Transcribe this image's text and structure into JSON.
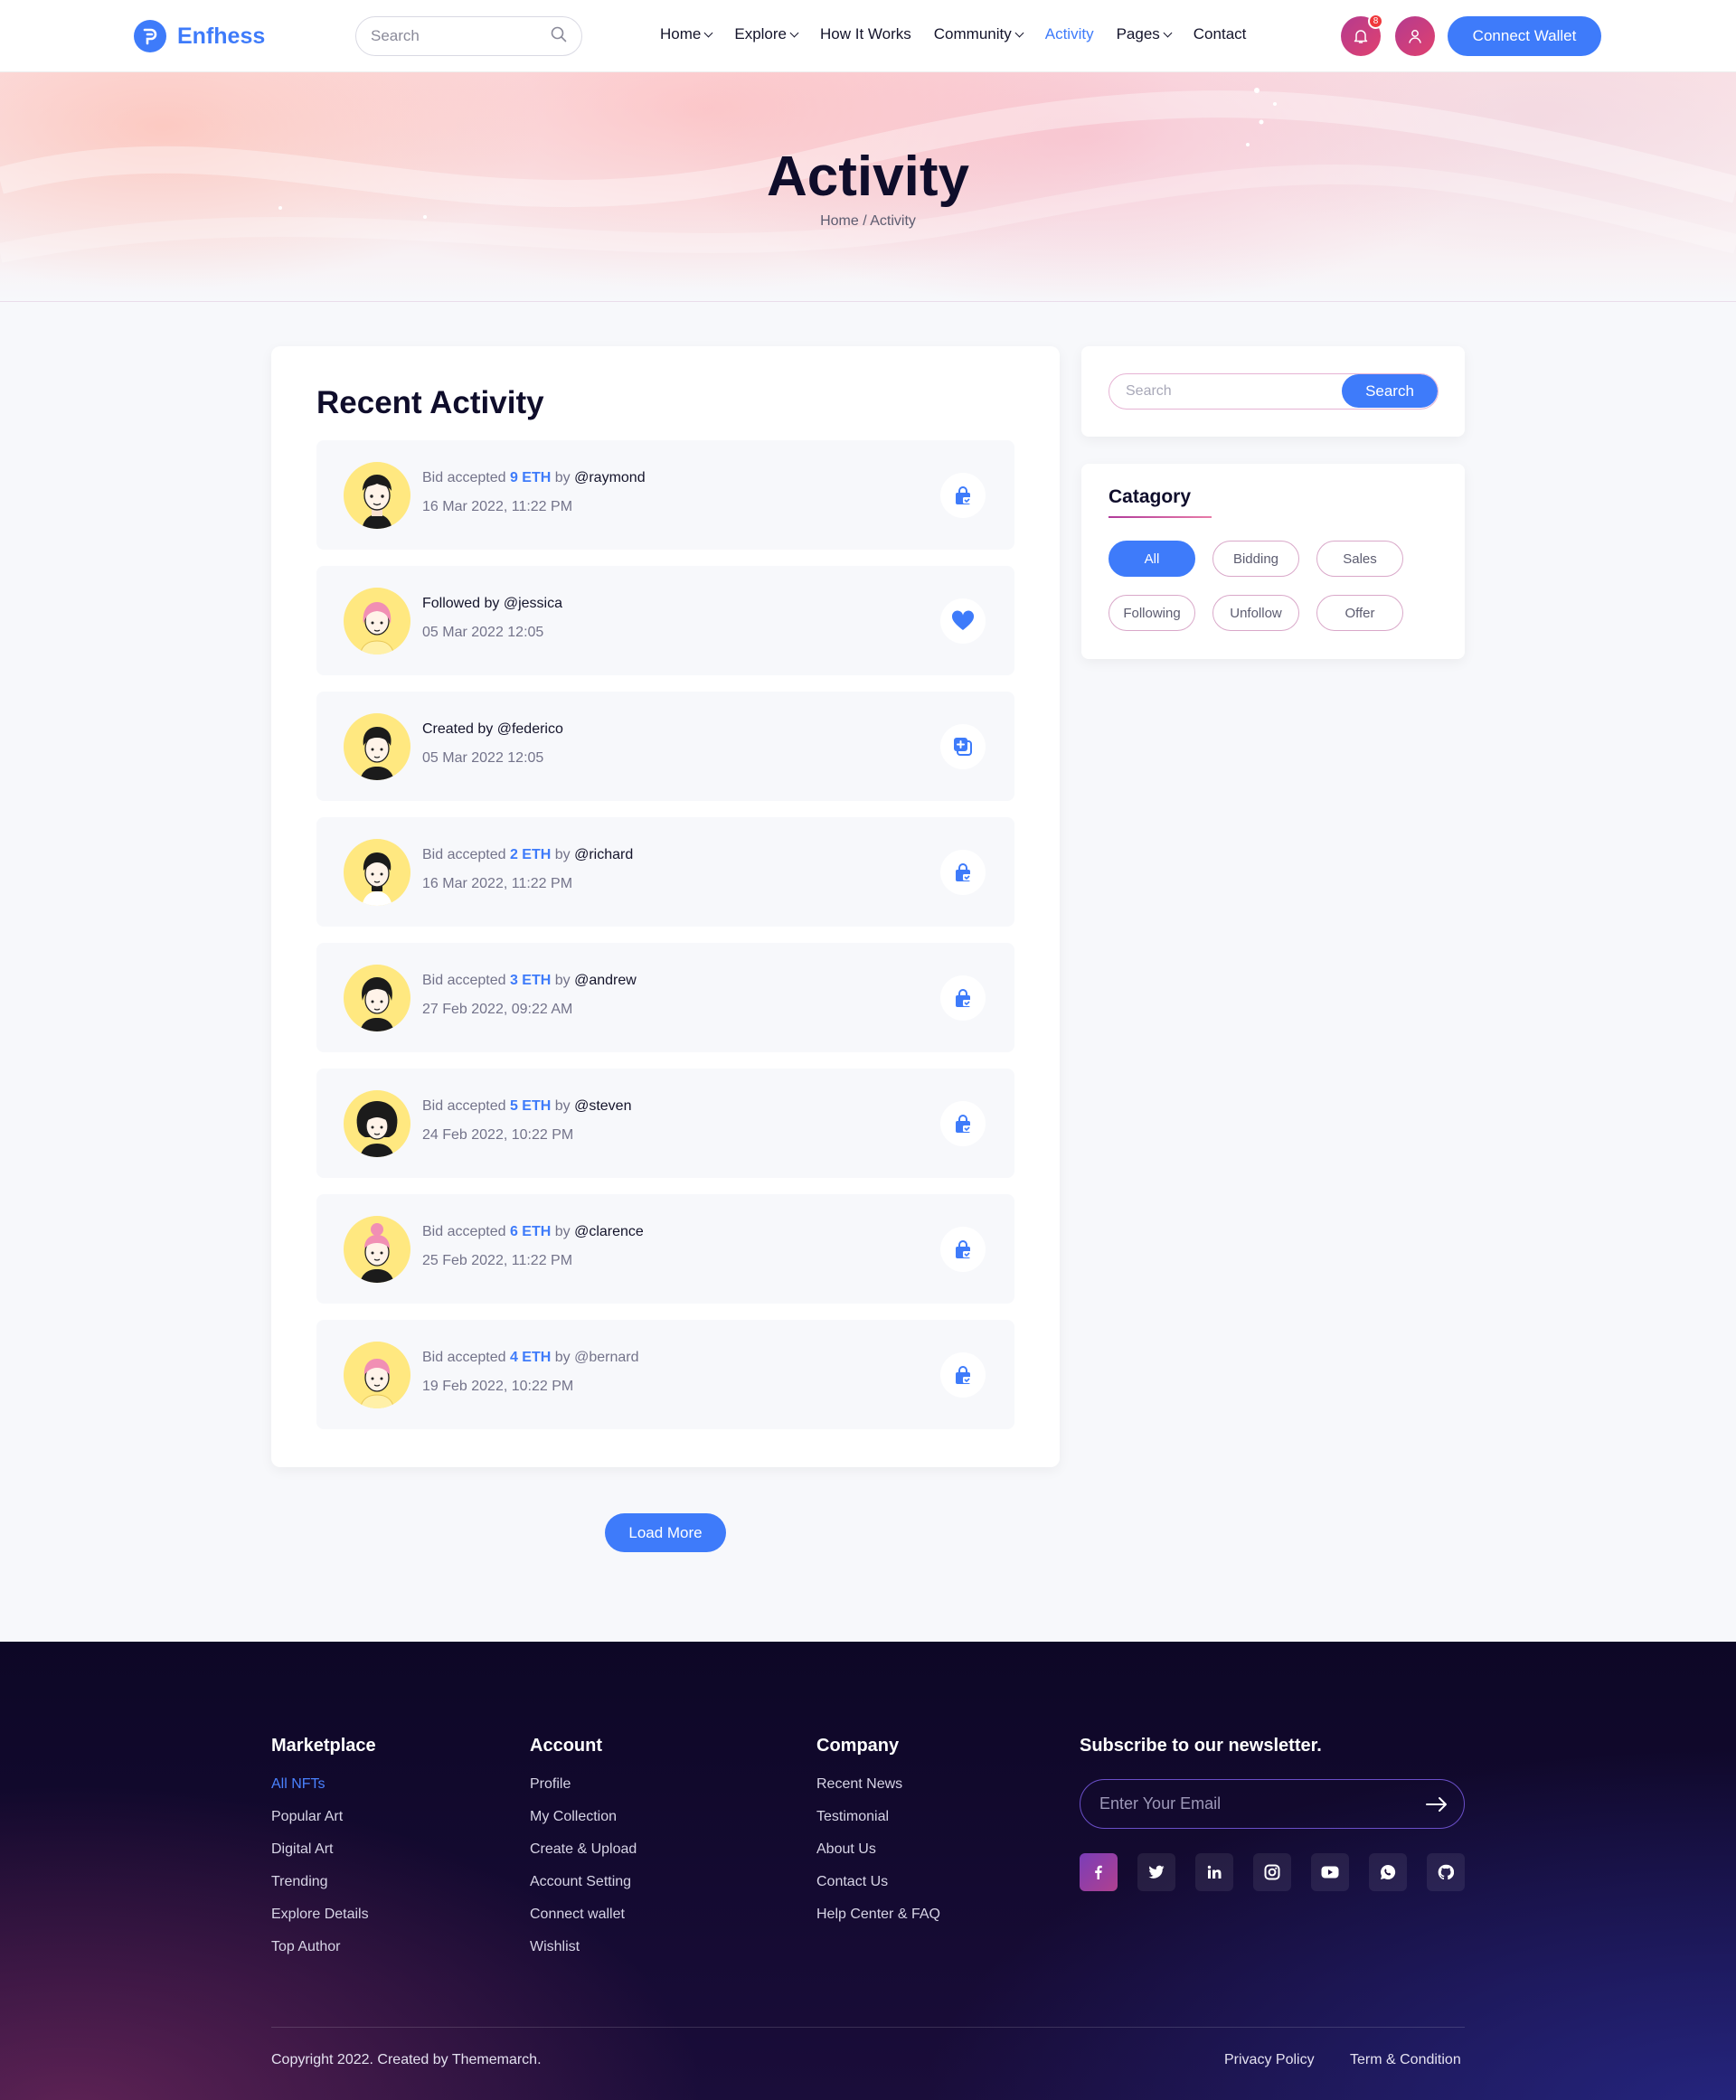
{
  "header": {
    "brand": "Enfhess",
    "search_placeholder": "Search",
    "nav": [
      {
        "label": "Home"
      },
      {
        "label": "Explore"
      },
      {
        "label": "How It Works"
      },
      {
        "label": "Community"
      },
      {
        "label": "Activity"
      },
      {
        "label": "Pages"
      },
      {
        "label": "Contact"
      }
    ],
    "notification_count": "8",
    "wallet_label": "Connect Wallet"
  },
  "hero": {
    "title": "Activity",
    "breadcrumb": "Home / Activity"
  },
  "activity": {
    "title": "Recent Activity",
    "items": [
      {
        "prefix": "Bid accepted ",
        "amount": "9 ETH",
        "mid": " by ",
        "user": "@raymond",
        "time": "16 Mar 2022, 11:22 PM",
        "icon": "bag-icon"
      },
      {
        "text": "Followed by @jessica",
        "time": "05 Mar 2022 12:05",
        "icon": "heart-icon"
      },
      {
        "text": "Created by @federico",
        "time": "05 Mar 2022 12:05",
        "icon": "add-layers-icon"
      },
      {
        "prefix": "Bid accepted ",
        "amount": "2 ETH",
        "mid": " by ",
        "user": "@richard",
        "time": "16 Mar 2022, 11:22 PM",
        "icon": "bag-icon"
      },
      {
        "prefix": "Bid accepted ",
        "amount": "3 ETH",
        "mid": " by ",
        "user": "@andrew",
        "time": "27 Feb 2022, 09:22 AM",
        "icon": "bag-icon"
      },
      {
        "prefix": "Bid accepted ",
        "amount": "5 ETH",
        "mid": " by ",
        "user": "@steven",
        "time": "24 Feb 2022, 10:22 PM",
        "icon": "bag-icon"
      },
      {
        "prefix": "Bid accepted ",
        "amount": "6 ETH",
        "mid": " by ",
        "user": "@clarence",
        "time": "25 Feb 2022, 11:22 PM",
        "icon": "bag-icon"
      },
      {
        "prefix": "Bid accepted ",
        "amount": "4 ETH",
        "mid": " by @bernard",
        "user": "",
        "time": "19 Feb 2022, 10:22 PM",
        "icon": "bag-icon"
      }
    ],
    "load_more": "Load More"
  },
  "sidebar": {
    "search_placeholder": "Search",
    "search_button": "Search",
    "category_title": "Catagory",
    "categories": [
      "All",
      "Bidding",
      "Sales",
      "Following",
      "Unfollow",
      "Offer"
    ],
    "active_category": "All"
  },
  "footer": {
    "columns": [
      {
        "title": "Marketplace",
        "links": [
          "All NFTs",
          "Popular Art",
          "Digital Art",
          "Trending",
          "Explore Details",
          "Top Author"
        ]
      },
      {
        "title": "Account",
        "links": [
          "Profile",
          "My Collection",
          "Create & Upload",
          "Account Setting",
          "Connect wallet",
          "Wishlist"
        ]
      },
      {
        "title": "Company",
        "links": [
          "Recent News",
          "Testimonial",
          "About Us",
          "Contact Us",
          "Help Center & FAQ"
        ]
      }
    ],
    "newsletter_title": "Subscribe to our newsletter.",
    "email_placeholder": "Enter Your Email",
    "socials": [
      "facebook-icon",
      "twitter-icon",
      "linkedin-icon",
      "instagram-icon",
      "youtube-icon",
      "whatsapp-icon",
      "github-icon"
    ],
    "copyright": "Copyright 2022. Created by Thememarch.",
    "privacy": "Privacy Policy",
    "terms": "Term & Condition"
  },
  "colors": {
    "accent": "#3e7bfa",
    "notification_gradient_start": "#b43b8f",
    "footer_bg": "#0d0726"
  }
}
